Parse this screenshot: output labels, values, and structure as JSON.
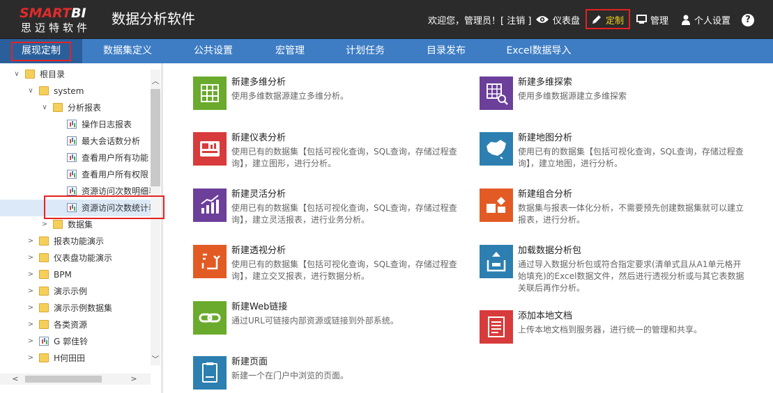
{
  "header": {
    "logo_brand_a": "SMART",
    "logo_brand_b": "BI",
    "logo_sub": "思迈特软件",
    "app_title": "数据分析软件",
    "welcome": "欢迎您，管理员！[ 注销 ]",
    "dashboard_label": "仪表盘",
    "customize_label": "定制",
    "manage_label": "管理",
    "personal_label": "个人设置",
    "help_label": "?"
  },
  "nav": {
    "items": [
      "展现定制",
      "数据集定义",
      "公共设置",
      "宏管理",
      "计划任务",
      "目录发布",
      "Excel数据导入"
    ]
  },
  "tree": [
    {
      "label": "根目录",
      "type": "folder",
      "expanded": true
    },
    {
      "label": "system",
      "type": "folder",
      "expanded": true
    },
    {
      "label": "分析报表",
      "type": "folder",
      "expanded": true
    },
    {
      "label": "操作日志报表",
      "type": "report"
    },
    {
      "label": "最大会话数分析",
      "type": "report"
    },
    {
      "label": "查看用户所有功能",
      "type": "report"
    },
    {
      "label": "查看用户所有权限",
      "type": "report"
    },
    {
      "label": "资源访问次数明细表",
      "type": "report"
    },
    {
      "label": "资源访问次数统计表",
      "type": "report",
      "selected": true
    },
    {
      "label": "数据集",
      "type": "folder"
    },
    {
      "label": "报表功能演示",
      "type": "folder"
    },
    {
      "label": "仪表盘功能演示",
      "type": "folder"
    },
    {
      "label": "BPM",
      "type": "folder"
    },
    {
      "label": "演示示例",
      "type": "folder"
    },
    {
      "label": "演示示例数据集",
      "type": "folder"
    },
    {
      "label": "各类资源",
      "type": "folder"
    },
    {
      "label": "G 郭佳铃",
      "type": "user"
    },
    {
      "label": "H何田田",
      "type": "folder"
    }
  ],
  "cards_left": [
    {
      "title": "新建多维分析",
      "desc": "使用多维数据源建立多维分析。",
      "color": "#6aaa2c",
      "icon": "cube-icon"
    },
    {
      "title": "新建仪表分析",
      "desc": "使用已有的数据集【包括可视化查询，SQL查询，存储过程查询】，建立图形，进行分析。",
      "color": "#d83b3b",
      "icon": "dashboard-icon"
    },
    {
      "title": "新建灵活分析",
      "desc": "使用已有的数据集【包括可视化查询，SQL查询，存储过程查询】，建立灵活报表，进行业务分析。",
      "color": "#6b3f9a",
      "icon": "bar-chart-icon"
    },
    {
      "title": "新建透视分析",
      "desc": "使用已有的数据集【包括可视化查询，SQL查询，存储过程查询】，建立交叉报表，进行数据分析。",
      "color": "#e25b24",
      "icon": "pivot-icon"
    },
    {
      "title": "新建Web链接",
      "desc": "通过URL可链接内部资源或链接到外部系统。",
      "color": "#6aaa2c",
      "icon": "link-icon"
    },
    {
      "title": "新建页面",
      "desc": "新建一个在门户中浏览的页面。",
      "color": "#2c7fb0",
      "icon": "page-icon"
    }
  ],
  "cards_right": [
    {
      "title": "新建多维探索",
      "desc": "使用多维数据源建立多维探索",
      "color": "#6b3f9a",
      "icon": "cube-search-icon"
    },
    {
      "title": "新建地图分析",
      "desc": "使用已有的数据集【包括可视化查询，SQL查询，存储过程查询】，建立地图，进行分析。",
      "color": "#2c7fb0",
      "icon": "map-icon"
    },
    {
      "title": "新建组合分析",
      "desc": "数据集与报表一体化分析，不需要预先创建数据集就可以建立报表，进行分析。",
      "color": "#e25b24",
      "icon": "shapes-icon"
    },
    {
      "title": "加载数据分析包",
      "desc": "通过导入数据分析包或符合指定要求(清单式且从A1单元格开始填充)的Excel数据文件，然后进行透视分析或与其它表数据关联后再作分析。",
      "color": "#2c7fb0",
      "icon": "upload-box-icon"
    },
    {
      "title": "添加本地文档",
      "desc": "上传本地文档到服务器，进行统一的管理和共享。",
      "color": "#d83b3b",
      "icon": "document-icon"
    }
  ]
}
